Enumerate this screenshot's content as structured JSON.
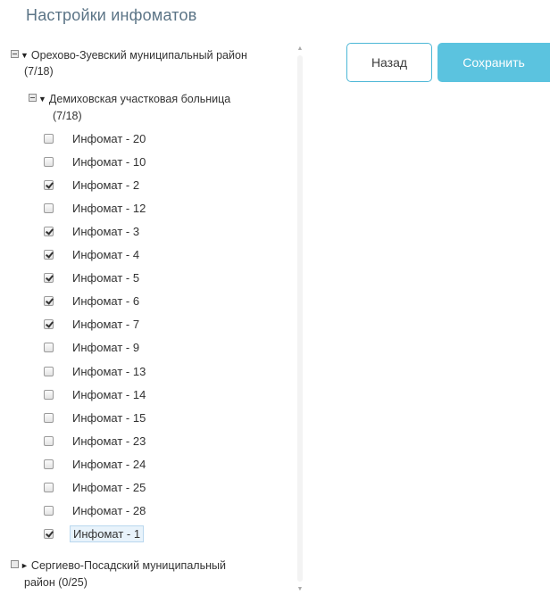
{
  "page": {
    "title": "Настройки инфоматов"
  },
  "buttons": {
    "back_label": "Назад",
    "save_label": "Сохранить"
  },
  "tree": {
    "district1": {
      "line1": "Орехово-Зуевский муниципальный район",
      "line2": "(7/18)",
      "expanded": true
    },
    "hospital": {
      "line1": "Демиховская участковая больница",
      "line2": "(7/18)",
      "expanded": true
    },
    "items": [
      {
        "label": "Инфомат - 20",
        "checked": false
      },
      {
        "label": "Инфомат - 10",
        "checked": false
      },
      {
        "label": "Инфомат - 2",
        "checked": true
      },
      {
        "label": "Инфомат - 12",
        "checked": false
      },
      {
        "label": "Инфомат - 3",
        "checked": true
      },
      {
        "label": "Инфомат - 4",
        "checked": true
      },
      {
        "label": "Инфомат - 5",
        "checked": true
      },
      {
        "label": "Инфомат - 6",
        "checked": true
      },
      {
        "label": "Инфомат - 7",
        "checked": true
      },
      {
        "label": "Инфомат - 9",
        "checked": false
      },
      {
        "label": "Инфомат - 13",
        "checked": false
      },
      {
        "label": "Инфомат - 14",
        "checked": false
      },
      {
        "label": "Инфомат - 15",
        "checked": false
      },
      {
        "label": "Инфомат - 23",
        "checked": false
      },
      {
        "label": "Инфомат - 24",
        "checked": false
      },
      {
        "label": "Инфомат - 25",
        "checked": false
      },
      {
        "label": "Инфомат - 28",
        "checked": false
      },
      {
        "label": "Инфомат - 1",
        "checked": true,
        "selected": true
      }
    ],
    "district2": {
      "line1": "Сергиево-Посадский муниципальный",
      "line2": "район (0/25)",
      "expanded": false
    }
  },
  "icons": {
    "collapse": "minus-box-icon",
    "expand": "square-box-icon",
    "arrow_down": "triangle-down-icon",
    "arrow_right": "triangle-right-icon"
  },
  "colors": {
    "accent": "#5bc3df",
    "border_accent": "#4cb7d6",
    "title": "#5b7486"
  }
}
